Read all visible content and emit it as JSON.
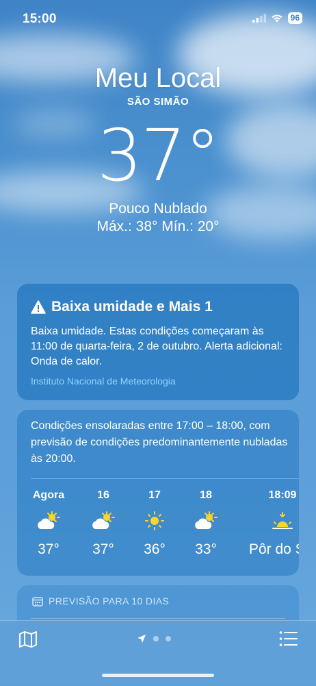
{
  "status_bar": {
    "time": "15:00",
    "battery": "96",
    "icons": [
      "cellular-signal-icon",
      "wifi-icon",
      "battery-icon"
    ]
  },
  "hero": {
    "location": "Meu Local",
    "sublocation": "SÃO SIMÃO",
    "temperature": "37°",
    "condition": "Pouco Nublado",
    "hi_lo": "Máx.: 38°  Mín.: 20°"
  },
  "alert": {
    "title": "Baixa umidade e Mais 1",
    "body": "Baixa umidade. Estas condições começaram às 11:00 de quarta-feira, 2 de outubro. Alerta adicional: Onda de calor.",
    "source": "Instituto Nacional de Meteorologia",
    "icon": "warning-icon"
  },
  "hourly": {
    "summary": "Condições ensolaradas entre 17:00 – 18:00, com previsão de condições predominantemente nubladas às 20:00.",
    "items": [
      {
        "label": "Agora",
        "icon": "partly-sunny-icon",
        "temp": "37°"
      },
      {
        "label": "16",
        "icon": "partly-sunny-icon",
        "temp": "37°"
      },
      {
        "label": "17",
        "icon": "sun-icon",
        "temp": "36°"
      },
      {
        "label": "18",
        "icon": "partly-sunny-icon",
        "temp": "33°"
      },
      {
        "label": "18:09",
        "icon": "sunset-icon",
        "temp": "Pôr do Sol"
      }
    ]
  },
  "forecast": {
    "label": "PREVISÃO PARA 10 DIAS",
    "icon": "calendar-icon"
  },
  "toolbar": {
    "icons": [
      "map-icon",
      "location-arrow-icon",
      "page-dot-icon",
      "list-icon"
    ]
  },
  "colors": {
    "sky_top": "#3f84c7",
    "sky_bottom": "#6aa9df",
    "accent_link": "#8fd3ff",
    "sun": "#ffd42a"
  }
}
